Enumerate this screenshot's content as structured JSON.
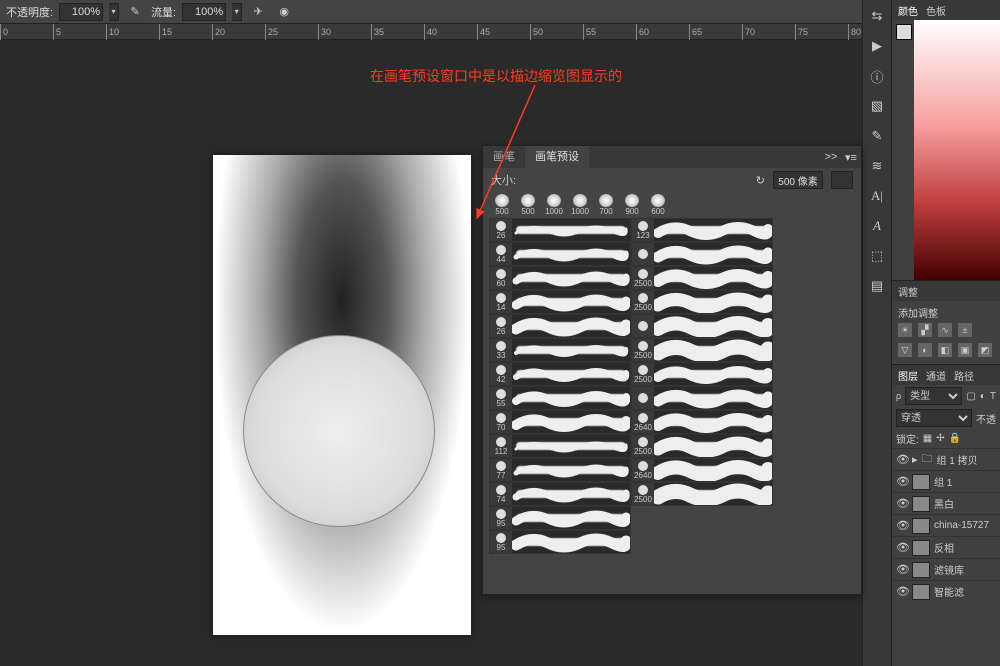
{
  "options_bar": {
    "opacity_label": "不透明度:",
    "opacity_value": "100%",
    "flow_label": "流量:",
    "flow_value": "100%"
  },
  "ruler_marks": [
    0,
    5,
    10,
    15,
    20,
    25,
    30,
    35,
    40,
    45,
    50,
    55,
    60,
    65,
    70,
    75,
    80
  ],
  "annotation_text": "在画笔预设窗口中是以描边缩览图显示的",
  "brush_panel": {
    "tab_brush": "画笔",
    "tab_presets": "画笔预设",
    "menu_icon": ">>",
    "flyout_icon": "▾≡",
    "size_label": "大小:",
    "reset_icon": "↻",
    "size_value": "500 像素",
    "top_brushes": [
      500,
      500,
      1000,
      1000,
      700,
      900,
      600
    ],
    "left_brushes": [
      26,
      44,
      60,
      14,
      26,
      33,
      42,
      55,
      70,
      112,
      77,
      74,
      95,
      95
    ],
    "right_brushes": [
      123,
      "",
      2500,
      2500,
      "",
      2500,
      2500,
      "",
      2640,
      2500,
      2640,
      2500
    ]
  },
  "right": {
    "color_tab": "颜色",
    "swatches_tab": "色板",
    "adjust_tab": "调整",
    "adjust_add": "添加调整",
    "layers_tab": "图层",
    "channels_tab": "通道",
    "paths_tab": "路径",
    "kind_label": "类型",
    "blend_mode": "穿透",
    "opacity_short": "不透",
    "lock_label": "锁定:",
    "layers": [
      {
        "name": "组 1 拷贝",
        "folder": true
      },
      {
        "name": "组 1",
        "folder": false
      },
      {
        "name": "黑白",
        "folder": false
      },
      {
        "name": "china-15727",
        "folder": false
      },
      {
        "name": "反相",
        "folder": false
      },
      {
        "name": "滤镜库",
        "folder": false
      },
      {
        "name": "智能滤",
        "folder": false
      }
    ]
  }
}
